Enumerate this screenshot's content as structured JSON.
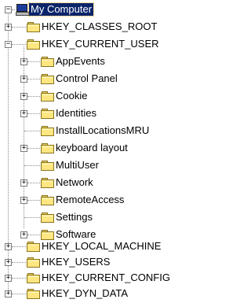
{
  "tree": {
    "root": {
      "label": "My Computer",
      "icon": "computer-icon",
      "expanded": true,
      "selected": true
    },
    "hkeys": [
      {
        "label": "HKEY_CLASSES_ROOT",
        "expanded": false,
        "has_children": true
      },
      {
        "label": "HKEY_CURRENT_USER",
        "expanded": true,
        "has_children": true
      },
      {
        "label": "HKEY_LOCAL_MACHINE",
        "expanded": false,
        "has_children": true
      },
      {
        "label": "HKEY_USERS",
        "expanded": false,
        "has_children": true
      },
      {
        "label": "HKEY_CURRENT_CONFIG",
        "expanded": false,
        "has_children": true
      },
      {
        "label": "HKEY_DYN_DATA",
        "expanded": false,
        "has_children": true
      }
    ],
    "current_user_children": [
      {
        "label": "AppEvents",
        "has_children": true
      },
      {
        "label": "Control Panel",
        "has_children": true
      },
      {
        "label": "Cookie",
        "has_children": true
      },
      {
        "label": "Identities",
        "has_children": true
      },
      {
        "label": "InstallLocationsMRU",
        "has_children": false
      },
      {
        "label": "keyboard layout",
        "has_children": true
      },
      {
        "label": "MultiUser",
        "has_children": false
      },
      {
        "label": "Network",
        "has_children": true
      },
      {
        "label": "RemoteAccess",
        "has_children": true
      },
      {
        "label": "Settings",
        "has_children": false
      },
      {
        "label": "Software",
        "has_children": true
      }
    ],
    "glyphs": {
      "collapsed": "+",
      "expanded": "−"
    },
    "colors": {
      "selection": "#0a246a",
      "folder": "#ffe680",
      "tree_line": "#8c8c8c"
    }
  }
}
